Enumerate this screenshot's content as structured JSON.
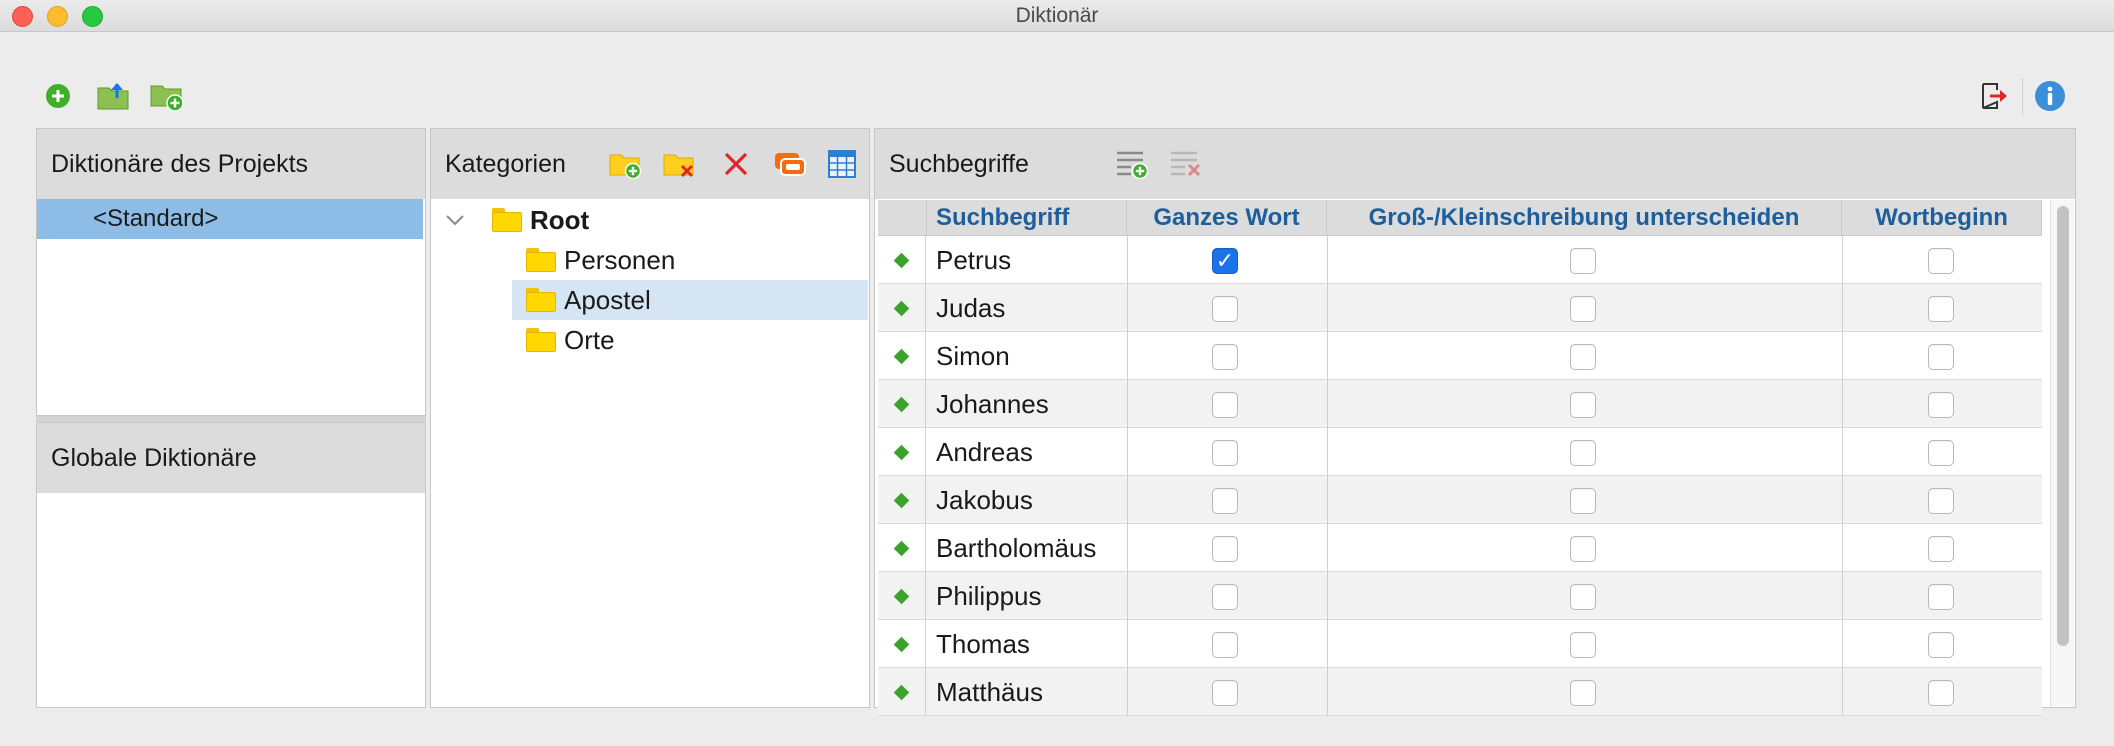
{
  "window": {
    "title": "Diktionär"
  },
  "toolbar": {
    "left_icons": [
      "add-circle-icon",
      "folder-export-icon",
      "folder-add-icon"
    ],
    "right_icons": [
      "exit-icon",
      "info-icon"
    ]
  },
  "project_dicts": {
    "header": "Diktionäre des Projekts",
    "items": [
      {
        "label": "<Standard>",
        "selected": true
      }
    ]
  },
  "global_dicts": {
    "header": "Globale Diktionäre",
    "items": []
  },
  "categories": {
    "header": "Kategorien",
    "tools": [
      "folder-add-icon",
      "folder-delete-icon",
      "delete-x-icon",
      "category-color-icon",
      "table-icon"
    ],
    "tree": {
      "root": "Root",
      "children": [
        {
          "label": "Personen"
        },
        {
          "label": "Apostel",
          "selected": true
        },
        {
          "label": "Orte"
        }
      ]
    }
  },
  "terms": {
    "header": "Suchbegriffe",
    "tools": [
      "add-term-icon",
      "delete-term-icon"
    ],
    "columns": [
      "Suchbegriff",
      "Ganzes Wort",
      "Groß-/Kleinschreibung unterscheiden",
      "Wortbeginn"
    ],
    "rows": [
      {
        "term": "Petrus",
        "whole_word": true,
        "case": false,
        "word_start": false
      },
      {
        "term": "Judas",
        "whole_word": false,
        "case": false,
        "word_start": false
      },
      {
        "term": "Simon",
        "whole_word": false,
        "case": false,
        "word_start": false
      },
      {
        "term": "Johannes",
        "whole_word": false,
        "case": false,
        "word_start": false
      },
      {
        "term": "Andreas",
        "whole_word": false,
        "case": false,
        "word_start": false
      },
      {
        "term": "Jakobus",
        "whole_word": false,
        "case": false,
        "word_start": false
      },
      {
        "term": "Bartholomäus",
        "whole_word": false,
        "case": false,
        "word_start": false
      },
      {
        "term": "Philippus",
        "whole_word": false,
        "case": false,
        "word_start": false
      },
      {
        "term": "Thomas",
        "whole_word": false,
        "case": false,
        "word_start": false
      },
      {
        "term": "Matthäus",
        "whole_word": false,
        "case": false,
        "word_start": false
      }
    ]
  },
  "colors": {
    "accent": "#1a74e8",
    "selection": "#8dbde6",
    "header_text": "#1d5e9c",
    "marker": "#3aa12c"
  }
}
